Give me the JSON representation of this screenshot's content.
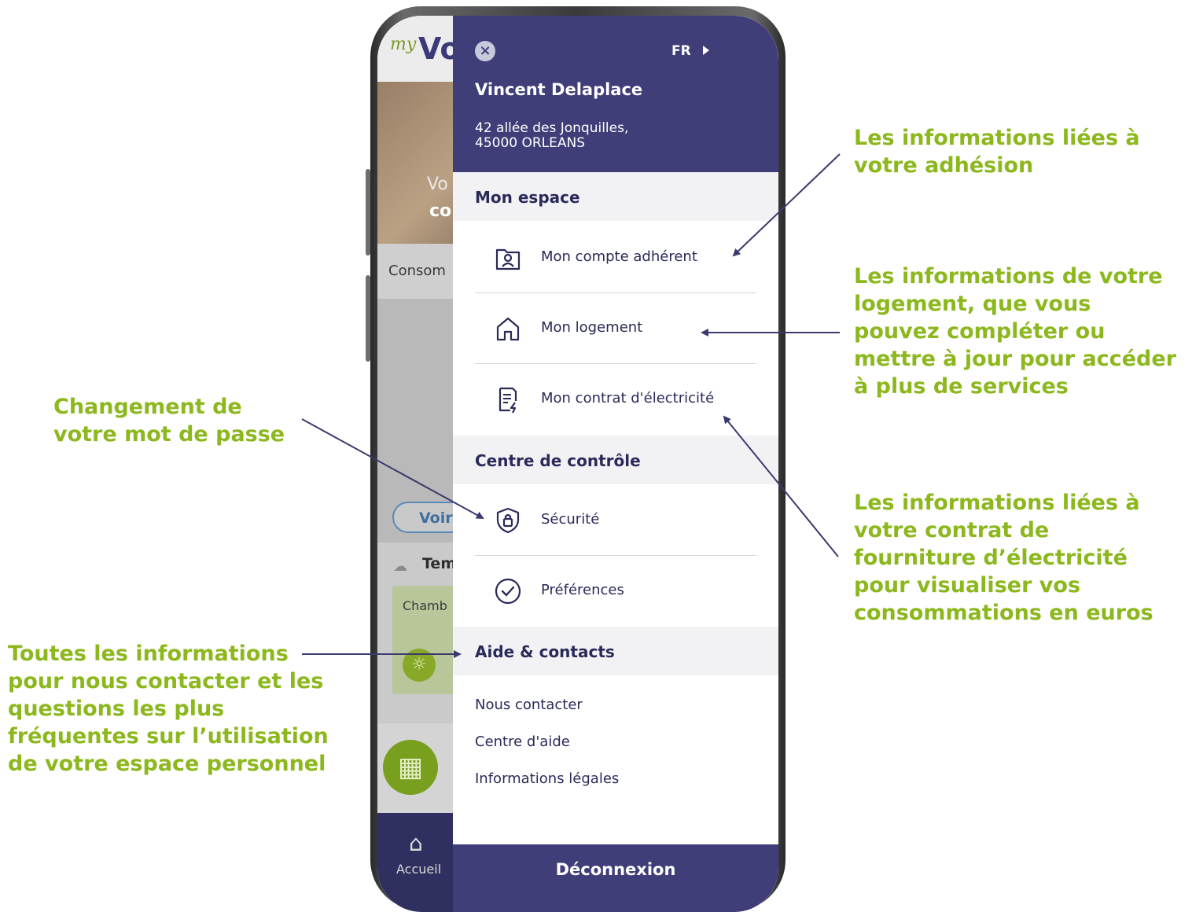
{
  "background_app": {
    "logo_my": "my",
    "logo_vo": "Vo",
    "hero_line1": "Vo",
    "hero_line2": "co",
    "conso_label": "Consom",
    "voir_button": "Voir",
    "temp_label": "Tem",
    "room_label": "Chamb",
    "bottom_nav": {
      "home_label": "Accueil"
    }
  },
  "drawer": {
    "language": "FR",
    "user": {
      "name": "Vincent Delaplace",
      "address_line1": "42 allée des Jonquilles,",
      "address_line2": "45000 ORLEANS"
    },
    "sections": {
      "mon_espace": {
        "title": "Mon espace",
        "items": [
          {
            "label": "Mon compte adhérent",
            "icon": "account-card-icon"
          },
          {
            "label": "Mon logement",
            "icon": "house-icon"
          },
          {
            "label": "Mon contrat d'électricité",
            "icon": "contract-electricity-icon"
          }
        ]
      },
      "centre_controle": {
        "title": "Centre de contrôle",
        "items": [
          {
            "label": "Sécurité",
            "icon": "shield-lock-icon"
          },
          {
            "label": "Préférences",
            "icon": "check-circle-icon"
          }
        ]
      },
      "aide": {
        "title": "Aide & contacts",
        "links": [
          "Nous contacter",
          "Centre d'aide",
          "Informations légales"
        ]
      }
    },
    "logout_label": "Déconnexion"
  },
  "annotations": {
    "adhesion": [
      "Les informations liées à",
      "votre adhésion"
    ],
    "logement": [
      "Les informations de votre",
      "logement, que vous",
      "pouvez compléter ou",
      "mettre à jour pour accéder",
      "à plus de services"
    ],
    "contrat": [
      "Les informations liées à",
      "votre contrat de",
      "fourniture d’électricité",
      "pour visualiser vos",
      "consommations en euros"
    ],
    "password": [
      "Changement de",
      "votre mot de passe"
    ],
    "contacts": [
      "Toutes les informations",
      "pour nous contacter et les",
      "questions les plus",
      "fréquentes sur l’utilisation",
      "de votre espace personnel"
    ]
  },
  "colors": {
    "annotation_green": "#8cb81e",
    "drawer_purple": "#403e78",
    "text_navy": "#2a2a5a",
    "arrow": "#3b3a6e"
  }
}
